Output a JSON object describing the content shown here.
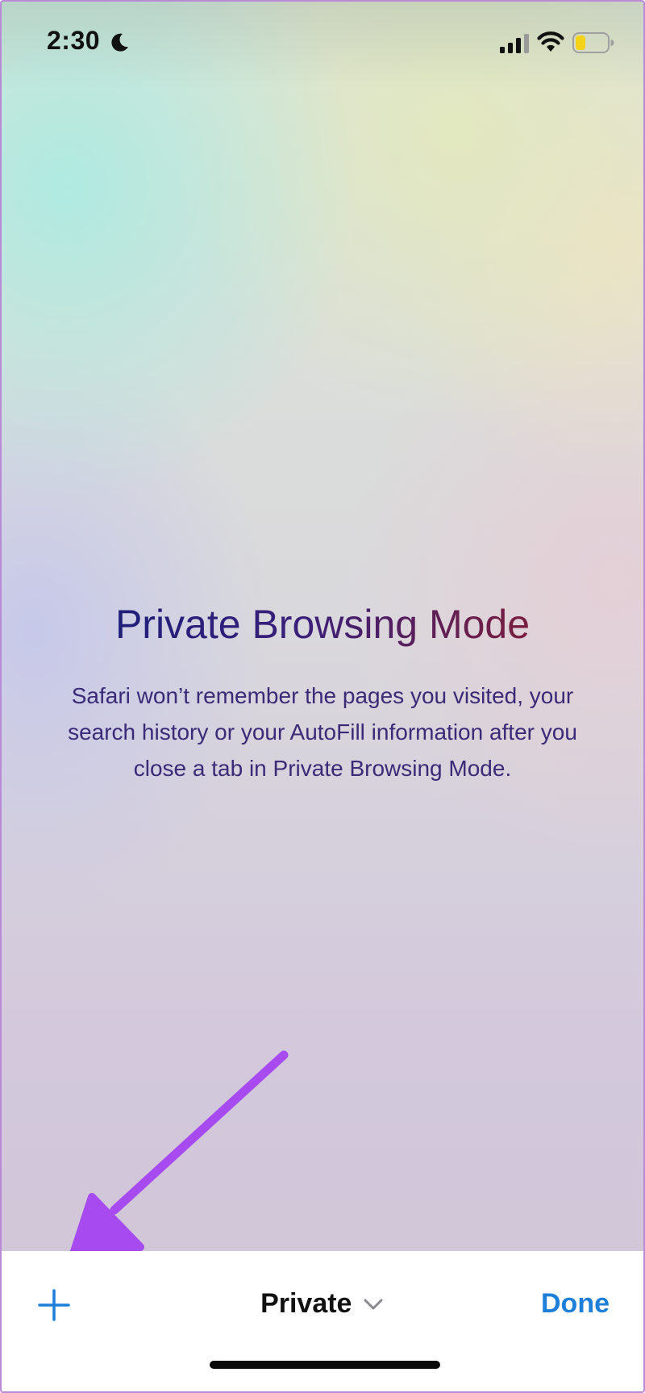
{
  "status_bar": {
    "time": "2:30",
    "moon_icon": "moon-icon",
    "signal_icon": "cellular-signal-icon",
    "wifi_icon": "wifi-icon",
    "battery_icon": "battery-icon",
    "battery_color": "#f5d21a"
  },
  "main": {
    "title": "Private Browsing Mode",
    "description": "Safari won’t remember the pages you visited, your search history or your AutoFill information after you close a tab in Private Browsing Mode."
  },
  "annotation": {
    "arrow_color": "#a74bf0"
  },
  "toolbar": {
    "new_tab_icon": "plus-icon",
    "tab_group_label": "Private",
    "tab_group_chevron": "chevron-down-icon",
    "done_label": "Done",
    "accent_color": "#1e7fd8"
  }
}
